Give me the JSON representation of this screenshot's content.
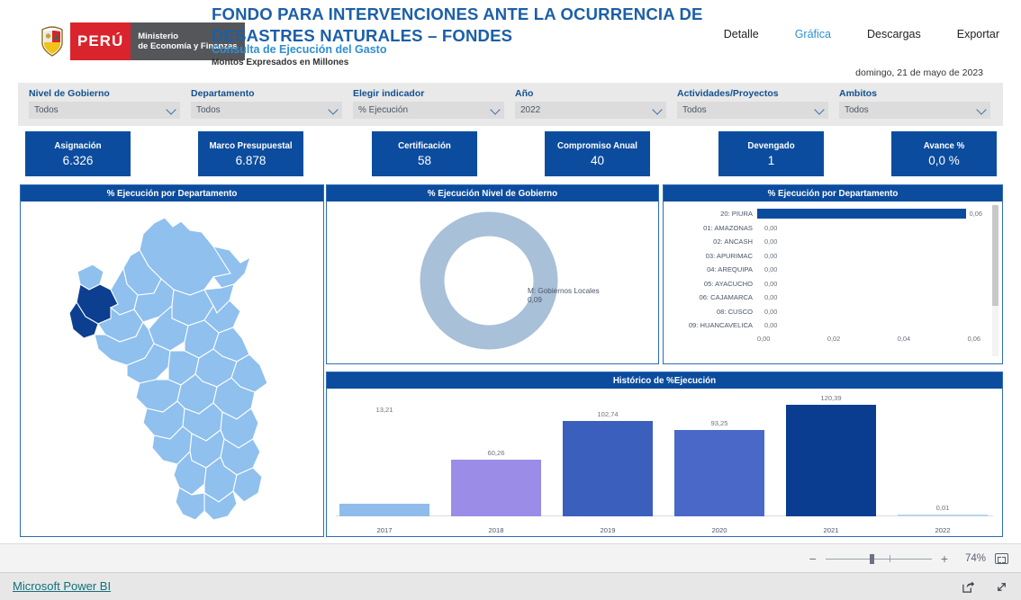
{
  "header": {
    "logo": {
      "country": "PERÚ",
      "ministry_line1": "Ministerio",
      "ministry_line2": "de Economía y Finanzas"
    },
    "title": "FONDO PARA INTERVENCIONES ANTE LA OCURRENCIA DE DESASTRES NATURALES – FONDES",
    "subtitle": "Consulta de Ejecución del Gasto",
    "note": "Montos Expresados en Millones",
    "date": "domingo, 21 de mayo de 2023",
    "nav": [
      {
        "label": "Detalle",
        "active": false
      },
      {
        "label": "Gráfica",
        "active": true
      },
      {
        "label": "Descargas",
        "active": false
      },
      {
        "label": "Exportar",
        "active": false
      }
    ]
  },
  "filters": [
    {
      "label": "Nivel de Gobierno",
      "value": "Todos"
    },
    {
      "label": "Departamento",
      "value": "Todos"
    },
    {
      "label": "Elegir indicador",
      "value": "% Ejecución"
    },
    {
      "label": "Año",
      "value": "2022"
    },
    {
      "label": "Actividades/Proyectos",
      "value": "Todos"
    },
    {
      "label": "Ambitos",
      "value": "Todos"
    }
  ],
  "kpis": [
    {
      "title": "Asignación",
      "value": "6.326"
    },
    {
      "title": "Marco Presupuestal",
      "value": "6.878"
    },
    {
      "title": "Certificación",
      "value": "58"
    },
    {
      "title": "Compromiso Anual",
      "value": "40"
    },
    {
      "title": "Devengado",
      "value": "1"
    },
    {
      "title": "Avance %",
      "value": "0,0 %"
    }
  ],
  "panels": {
    "map_title": "% Ejecución por Departamento",
    "donut_title": "% Ejecución Nivel de Gobierno",
    "dept_title": "% Ejecución por Departamento",
    "hist_title": "Histórico de  %Ejecución"
  },
  "chart_data": [
    {
      "type": "map",
      "title": "% Ejecución por Departamento",
      "regions_highlighted": [
        "PIURA"
      ],
      "colors": {
        "base": "#8FC0EE",
        "highlight": "#0C3F8F",
        "border": "#ffffff"
      }
    },
    {
      "type": "pie",
      "title": "% Ejecución Nivel de Gobierno",
      "labels": [
        "M: Gobiernos Locales"
      ],
      "values": [
        0.09
      ],
      "value_labels": [
        "0,09"
      ],
      "colors": [
        "#A8C0D8"
      ],
      "legend_position": "callout-right",
      "donut": true
    },
    {
      "type": "bar",
      "orientation": "horizontal",
      "title": "% Ejecución por Departamento",
      "categories": [
        "20: PIURA",
        "01: AMAZONAS",
        "02: ANCASH",
        "03: APURIMAC",
        "04: AREQUIPA",
        "05: AYACUCHO",
        "06: CAJAMARCA",
        "08: CUSCO",
        "09: HUANCAVELICA"
      ],
      "values": [
        0.06,
        0.0,
        0.0,
        0.0,
        0.0,
        0.0,
        0.0,
        0.0,
        0.0
      ],
      "value_labels": [
        "0,06",
        "0,00",
        "0,00",
        "0,00",
        "0,00",
        "0,00",
        "0,00",
        "0,00",
        "0,00"
      ],
      "xticks": [
        "0,00",
        "0,02",
        "0,04",
        "0,06"
      ],
      "xlim": [
        0,
        0.06
      ],
      "xlabel": "",
      "ylabel": "",
      "grid": false,
      "bar_color": "#0C4C9E"
    },
    {
      "type": "bar",
      "orientation": "vertical",
      "title": "Histórico de  %Ejecución",
      "categories": [
        "2017",
        "2018",
        "2019",
        "2020",
        "2021",
        "2022"
      ],
      "values": [
        13.21,
        60.26,
        102.74,
        93.25,
        120.39,
        0.01
      ],
      "value_labels": [
        "13,21",
        "60,26",
        "102,74",
        "93,25",
        "120,39",
        "0,01"
      ],
      "bar_colors": [
        "#8FBCEB",
        "#9B8CE8",
        "#3A5FBC",
        "#4A68C8",
        "#0A3D8F",
        "#B9D3F0"
      ],
      "ylim": [
        0,
        130
      ],
      "xlabel": "",
      "ylabel": "",
      "grid": false
    }
  ],
  "zoombar": {
    "minus": "−",
    "plus": "+",
    "percent": "74%"
  },
  "footer": {
    "brand": "Microsoft Power BI"
  }
}
